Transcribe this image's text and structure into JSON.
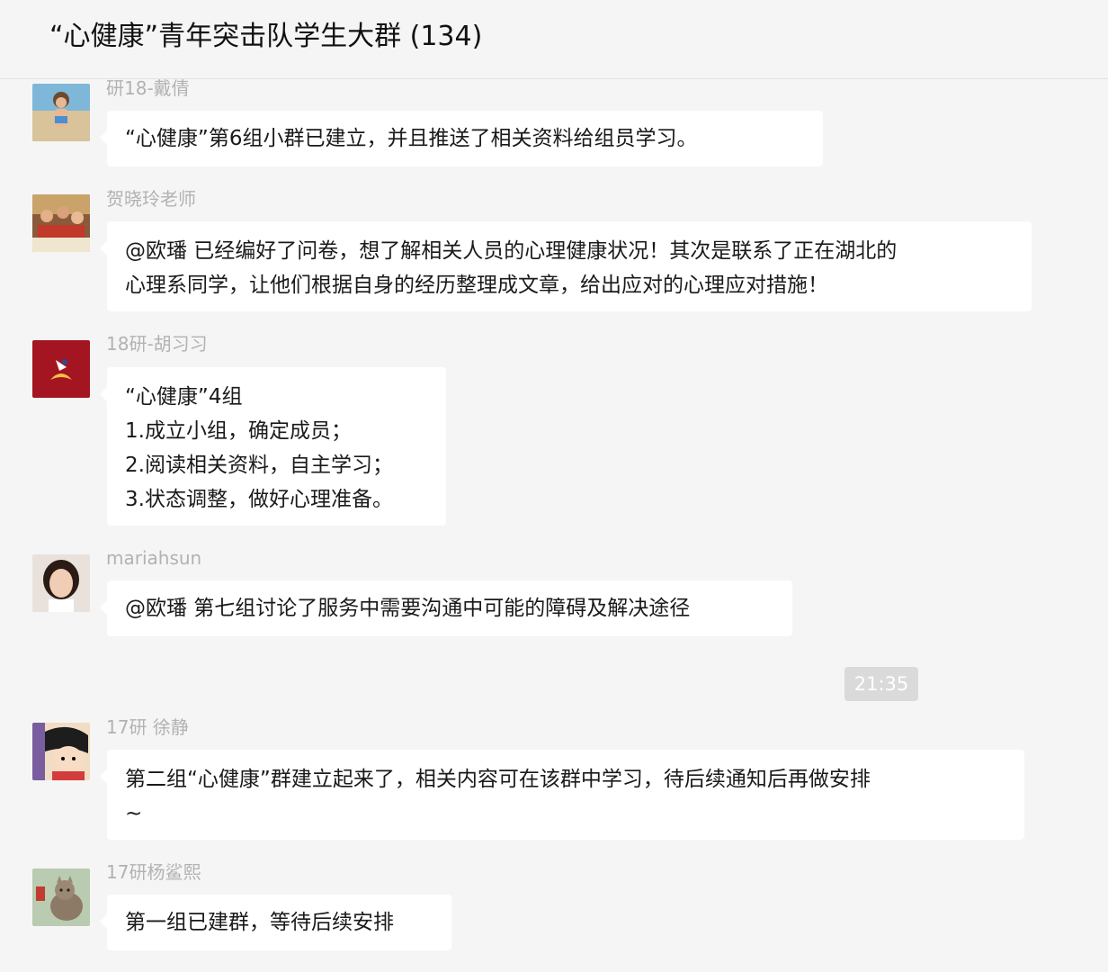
{
  "header": {
    "title": "“心健康”青年突击队学生大群 (134)"
  },
  "messages": [
    {
      "sender": "研18-戴倩",
      "avatar": "child-beach-avatar-icon",
      "lines": [
        "“心健康”第6组小群已建立，并且推送了相关资料给组员学习。"
      ]
    },
    {
      "sender": "贺晓玲老师",
      "avatar": "group-photo-avatar-icon",
      "lines": [
        "@欧璠 已经编好了问卷，想了解相关人员的心理健康状况！其次是联系了正在湖北的",
        "心理系同学，让他们根据自身的经历整理成文章，给出应对的心理应对措施！"
      ]
    },
    {
      "sender": "18研-胡习习",
      "avatar": "red-logo-avatar-icon",
      "lines": [
        "“心健康”4组",
        "1.成立小组，确定成员；",
        "2.阅读相关资料，自主学习；",
        "3.状态调整，做好心理准备。"
      ]
    },
    {
      "sender": "mariahsun",
      "avatar": "portrait-avatar-icon",
      "lines": [
        "@欧璠 第七组讨论了服务中需要沟通中可能的障碍及解决途径"
      ]
    },
    {
      "sender": "17研 徐静",
      "avatar": "cartoon-girl-avatar-icon",
      "lines": [
        "第二组“心健康”群建立起来了，相关内容可在该群中学习，待后续通知后再做安排",
        "~"
      ]
    },
    {
      "sender": "17研杨鲨熙",
      "avatar": "cat-avatar-icon",
      "lines": [
        "第一组已建群，等待后续安排"
      ]
    }
  ],
  "timestamp": "21:35",
  "colors": {
    "background": "#f5f5f5",
    "bubble": "#ffffff",
    "sender_name": "#b2b2b2",
    "time_badge": "#dadada"
  }
}
